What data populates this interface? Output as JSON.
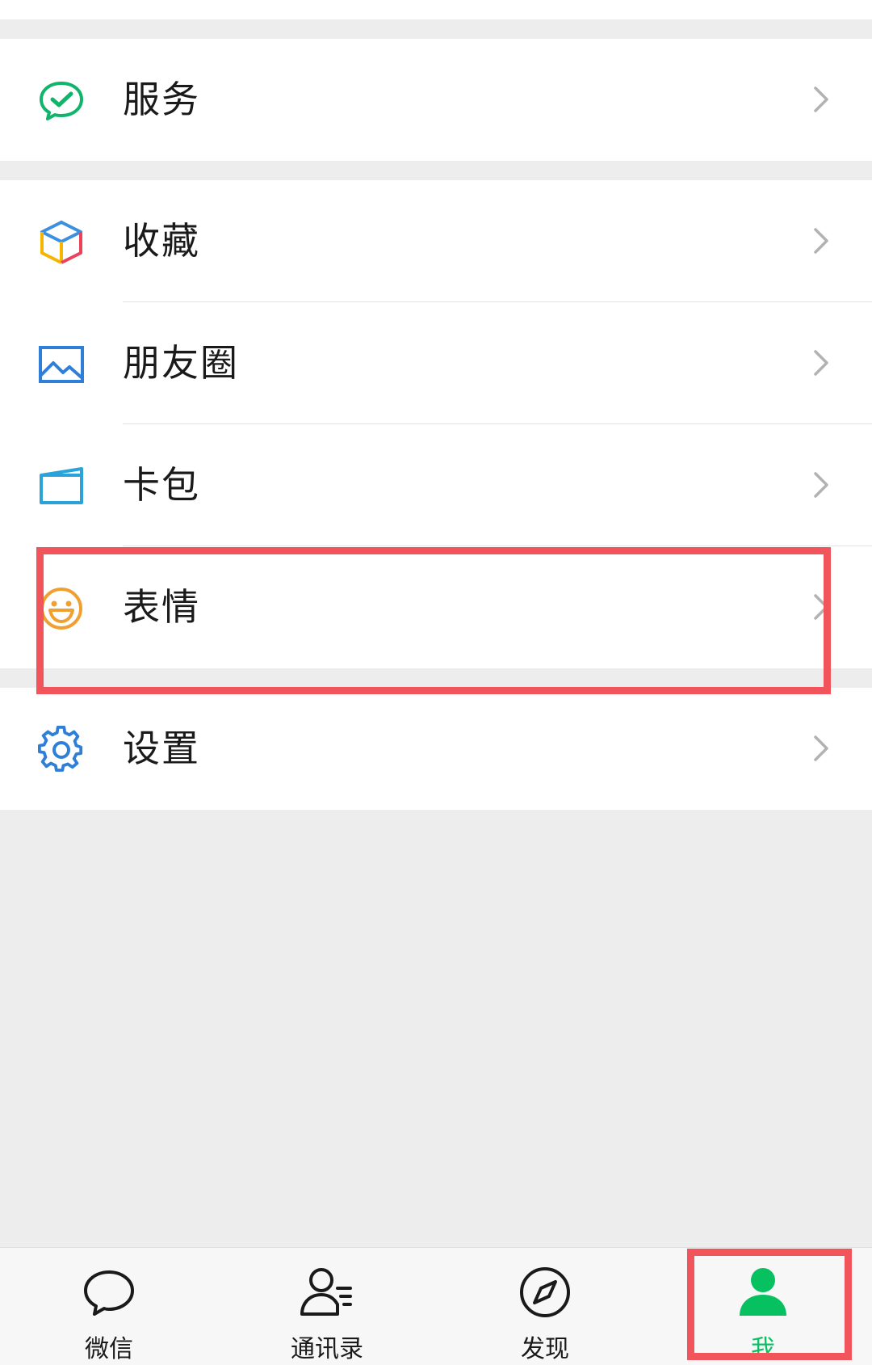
{
  "menu": {
    "group1": [
      {
        "label": "服务",
        "icon": "service-check-icon"
      }
    ],
    "group2": [
      {
        "label": "收藏",
        "icon": "favorites-cube-icon"
      },
      {
        "label": "朋友圈",
        "icon": "moments-image-icon"
      },
      {
        "label": "卡包",
        "icon": "card-wallet-icon"
      },
      {
        "label": "表情",
        "icon": "sticker-smile-icon"
      }
    ],
    "group3": [
      {
        "label": "设置",
        "icon": "settings-gear-icon"
      }
    ]
  },
  "tabbar": {
    "items": [
      {
        "label": "微信",
        "icon": "chat-bubble-icon",
        "active": false
      },
      {
        "label": "通讯录",
        "icon": "contacts-icon",
        "active": false
      },
      {
        "label": "发现",
        "icon": "compass-icon",
        "active": false
      },
      {
        "label": "我",
        "icon": "person-icon",
        "active": true
      }
    ]
  },
  "colors": {
    "brand_green": "#07c160",
    "annotation_red": "#f2545b",
    "background": "#ededed"
  }
}
